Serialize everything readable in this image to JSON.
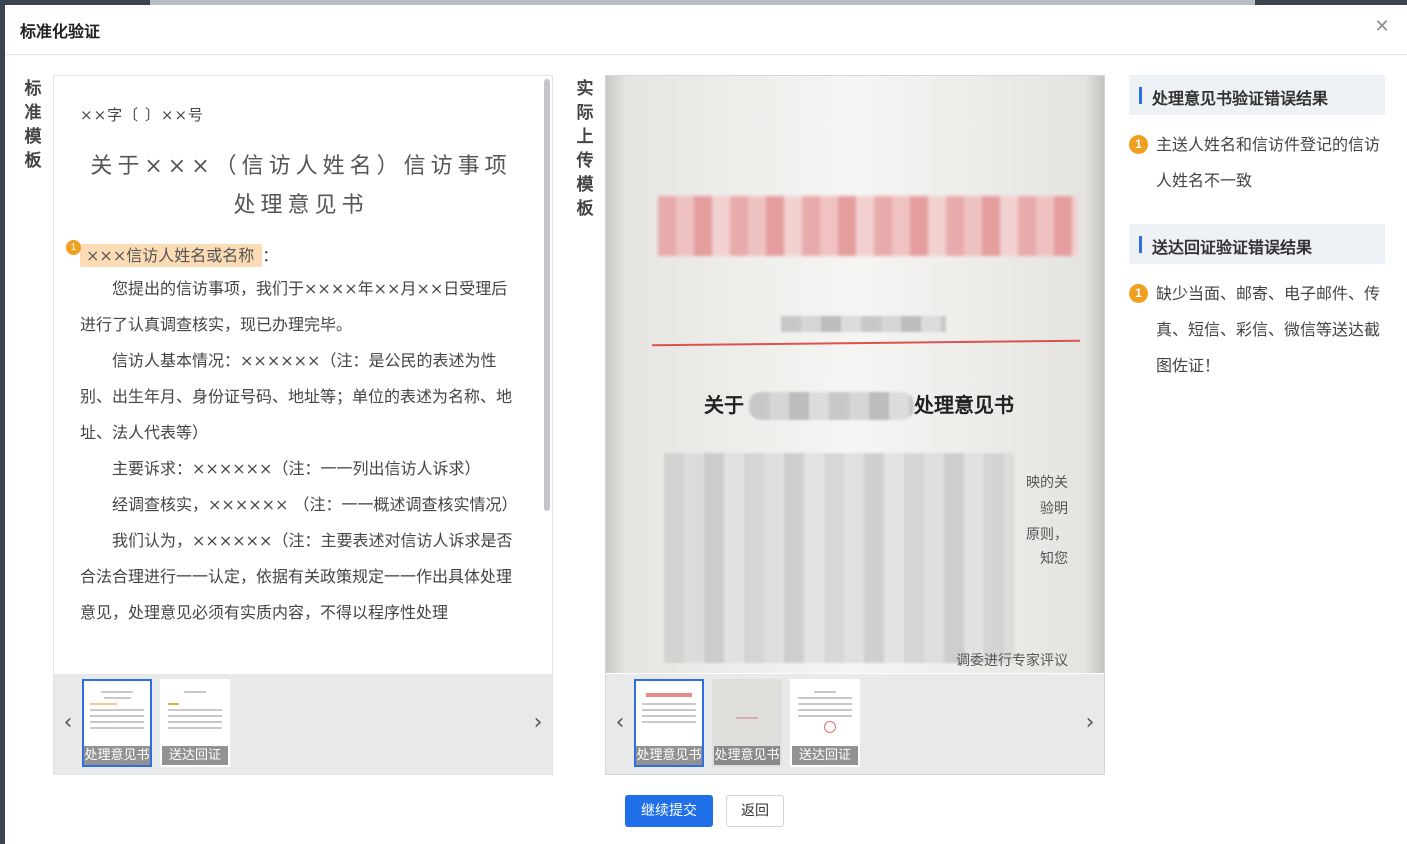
{
  "dialog": {
    "title": "标准化验证",
    "close_icon": "close-icon"
  },
  "standard": {
    "label": "标准模板",
    "doc": {
      "number": "××字〔 〕××号",
      "title_line1": "关于×××（信访人姓名）信访事项",
      "title_line2": "处理意见书",
      "error_badge": "1",
      "salutation_name": "×××信访人姓名或名称",
      "salutation_colon": "：",
      "paragraphs": [
        "您提出的信访事项，我们于××××年××月××日受理后进行了认真调查核实，现已办理完毕。",
        "信访人基本情况：××××××（注：是公民的表述为性别、出生年月、身份证号码、地址等；单位的表述为名称、地址、法人代表等）",
        "主要诉求：××××××（注：一一列出信访人诉求）",
        "经调查核实，×××××× （注：一一概述调查核实情况）",
        "我们认为，××××××（注：主要表述对信访人诉求是否合法合理进行一一认定，依据有关政策规定一一作出具体处理意见，处理意见必须有实质内容，不得以程序性处理"
      ]
    },
    "thumbnails": [
      "处理意见书",
      "送达回证"
    ]
  },
  "actual": {
    "label": "实际上传模板",
    "photo_title_left": "关于",
    "photo_title_right": "处理意见书",
    "photo_fragments": [
      "映的关",
      "验明",
      "原则，",
      "知您",
      "调委进行专家评议"
    ],
    "thumbnails": [
      "处理意见书",
      "处理意见书",
      "送达回证"
    ]
  },
  "results": [
    {
      "heading": "处理意见书验证错误结果",
      "items": [
        {
          "badge": "1",
          "text": "主送人姓名和信访件登记的信访人姓名不一致"
        }
      ]
    },
    {
      "heading": "送达回证验证错误结果",
      "items": [
        {
          "badge": "1",
          "text": "缺少当面、邮寄、电子邮件、传真、短信、彩信、微信等送达截图佐证！"
        }
      ]
    }
  ],
  "buttons": {
    "continue": "继续提交",
    "back": "返回"
  },
  "colors": {
    "primary": "#1e6fe8",
    "warning": "#f0a020",
    "highlight": "#fbdcb4"
  }
}
